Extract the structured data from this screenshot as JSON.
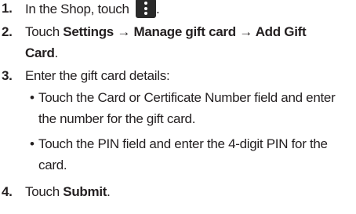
{
  "steps": [
    {
      "number": "1.",
      "text_before": "In the Shop, touch",
      "icon": "more-options-vertical-dots-icon",
      "text_after": "."
    },
    {
      "number": "2.",
      "prefix": "Touch ",
      "path_line1": "Settings → Manage gift card → Add Gift",
      "path_line2": "Card",
      "suffix": "."
    },
    {
      "number": "3.",
      "text": "Enter the gift card details:",
      "bullets": [
        {
          "line1": "Touch the Card or Certificate Number field and enter",
          "line2": "the number for the gift card."
        },
        {
          "line1": "Touch the PIN field and enter the 4-digit PIN for the",
          "line2": "card."
        }
      ]
    },
    {
      "number": "4.",
      "prefix": "Touch ",
      "bold": "Submit",
      "suffix": "."
    }
  ],
  "bullet_symbol": "•"
}
